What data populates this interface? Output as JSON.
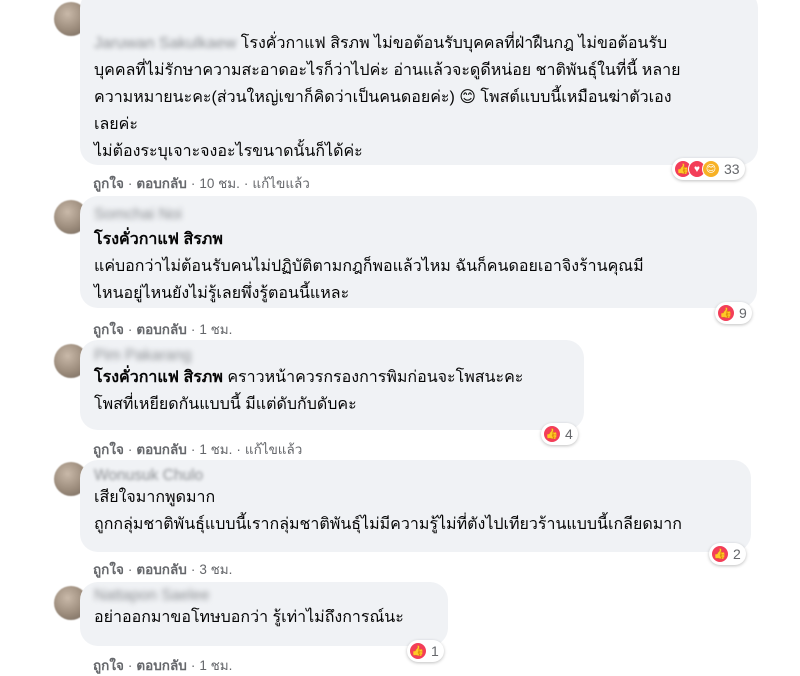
{
  "comments": [
    {
      "name": "Jaruwan Sakulkaew",
      "lines": [
        {
          "prefix": "Jaruwan Sakulkaew",
          "text": "โรงคั่วกาแฟ สิรภพ ไม่ขอต้อนรับบุคคลที่ฝ่าฝืนกฎ ไม่ขอต้อนรับ"
        },
        {
          "text": "บุคคลที่ไม่รักษาความสะอาดอะไรก็ว่าไปค่ะ อ่านแล้วจะดูดีหน่อย ชาติพันธุ์ในที่นี้ หลาย"
        },
        {
          "text": "ความหมายนะคะ(ส่วนใหญ่เขาก็คิดว่าเป็นคนดอยค่ะ) 😊 โพสต์แบบนี้เหมือนฆ่าตัวเอง"
        },
        {
          "text": "เลยค่ะ"
        },
        {
          "text": "ไม่ต้องระบุเจาะจงอะไรขนาดนั้นก็ได้ค่ะ"
        }
      ],
      "actions": {
        "like": "ถูกใจ",
        "reply": "ตอบกลับ",
        "time": "10 ชม.",
        "edited": "แก้ไขแล้ว"
      },
      "reactions": {
        "icons": [
          "like-icon",
          "love-icon",
          "care-icon"
        ],
        "count": "33"
      }
    },
    {
      "name": "Somchai Noi",
      "lines": [
        {
          "author": "โรงคั่วกาแฟ สิรภพ"
        },
        {
          "text": "แค่บอกว่าไม่ต้อนรับคนไม่ปฏิบัติตามกฎก็พอแล้วไหม ฉันก็คนดอยเอาจิงร้านคุณมี"
        },
        {
          "text": "ไหนอยู่ไหนยังไม่รู้เลยพึ่งรู้ตอนนี้แหละ"
        }
      ],
      "actions": {
        "like": "ถูกใจ",
        "reply": "ตอบกลับ",
        "time": "1 ชม."
      },
      "reactions": {
        "icons": [
          "like-icon"
        ],
        "count": "9"
      }
    },
    {
      "name": "Pim Pakarang",
      "lines": [
        {
          "author": "โรงคั่วกาแฟ สิรภพ",
          "text": " คราวหน้าควรกรองการพิมก่อนจะโพสนะคะ"
        },
        {
          "text": "โพสที่เหยียดกันแบบนี้ มีแต่ดับกับดับคะ"
        }
      ],
      "actions": {
        "like": "ถูกใจ",
        "reply": "ตอบกลับ",
        "time": "1 ชม.",
        "edited": "แก้ไขแล้ว"
      },
      "reactions": {
        "icons": [
          "like-icon"
        ],
        "count": "4"
      }
    },
    {
      "name": "Wonusuk Chulo",
      "lines": [
        {
          "text": "เสียใจมากพูดมาก"
        },
        {
          "text": "ถูกกลุ่มชาติพันธุ์แบบนี้เรากลุ่มชาติพันธุ์ไม่มีความรู้ไม่ที่ตังไปเทียวร้านแบบนี้เกลียดมาก"
        }
      ],
      "actions": {
        "like": "ถูกใจ",
        "reply": "ตอบกลับ",
        "time": "3 ชม."
      },
      "reactions": {
        "icons": [
          "like-icon"
        ],
        "count": "2"
      }
    },
    {
      "name": "Nattapon Saelee",
      "lines": [
        {
          "text": "อย่าออกมาขอโทษบอกว่า รู้เท่าไม่ถึงการณ์นะ"
        }
      ],
      "actions": {
        "like": "ถูกใจ",
        "reply": "ตอบกลับ",
        "time": "1 ชม."
      },
      "reactions": {
        "icons": [
          "like-icon"
        ],
        "count": "1"
      }
    }
  ]
}
